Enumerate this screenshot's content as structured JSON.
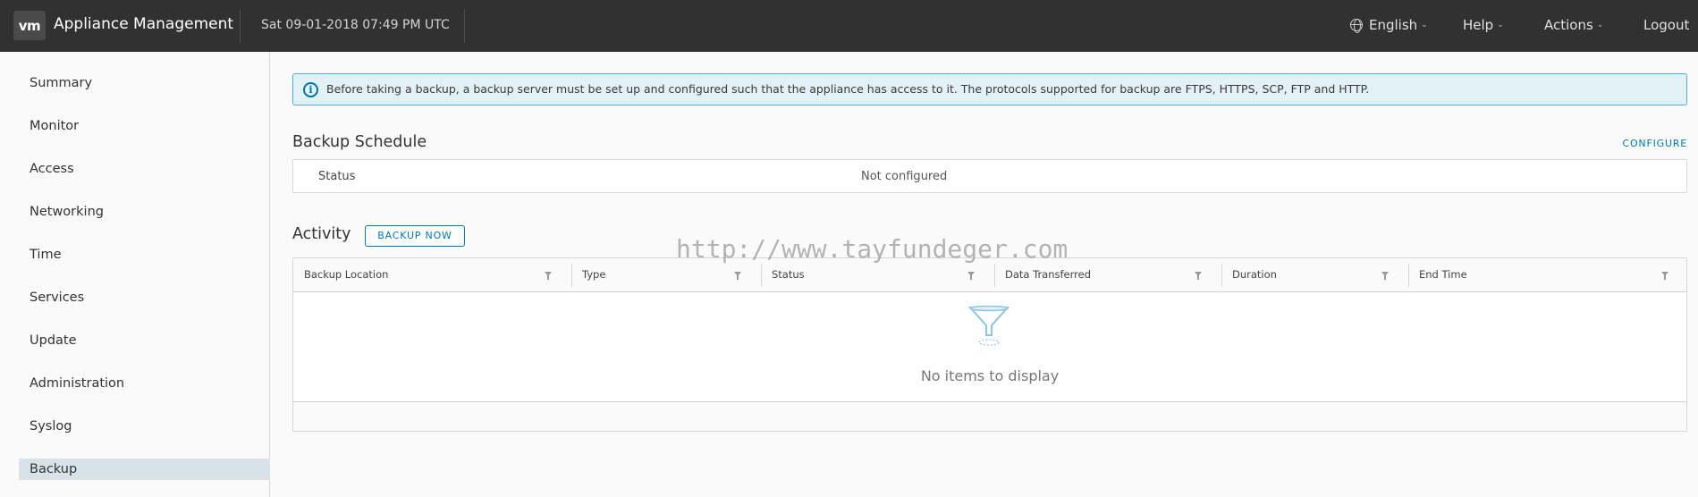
{
  "header": {
    "logo_text": "vm",
    "app_title": "Appliance Management",
    "datetime": "Sat 09-01-2018 07:49 PM UTC",
    "language": "English",
    "help": "Help",
    "actions": "Actions",
    "logout": "Logout"
  },
  "sidebar": {
    "items": [
      {
        "label": "Summary"
      },
      {
        "label": "Monitor"
      },
      {
        "label": "Access"
      },
      {
        "label": "Networking"
      },
      {
        "label": "Time"
      },
      {
        "label": "Services"
      },
      {
        "label": "Update"
      },
      {
        "label": "Administration"
      },
      {
        "label": "Syslog"
      },
      {
        "label": "Backup",
        "active": true
      }
    ]
  },
  "main": {
    "alert_text": "Before taking a backup, a backup server must be set up and configured such that the appliance has access to it. The protocols supported for backup are FTPS, HTTPS, SCP, FTP and HTTP.",
    "schedule": {
      "title": "Backup Schedule",
      "configure_label": "CONFIGURE",
      "status_label": "Status",
      "status_value": "Not configured"
    },
    "activity": {
      "title": "Activity",
      "backup_now_label": "BACKUP NOW",
      "columns": [
        "Backup Location",
        "Type",
        "Status",
        "Data Transferred",
        "Duration",
        "End Time"
      ],
      "empty_text": "No items to display"
    }
  },
  "watermark": "http://www.tayfundeger.com",
  "colors": {
    "header_bg": "#313131",
    "accent": "#0079b8",
    "alert_bg": "#e1f1f6",
    "active_nav_bg": "#d8e3e9"
  }
}
